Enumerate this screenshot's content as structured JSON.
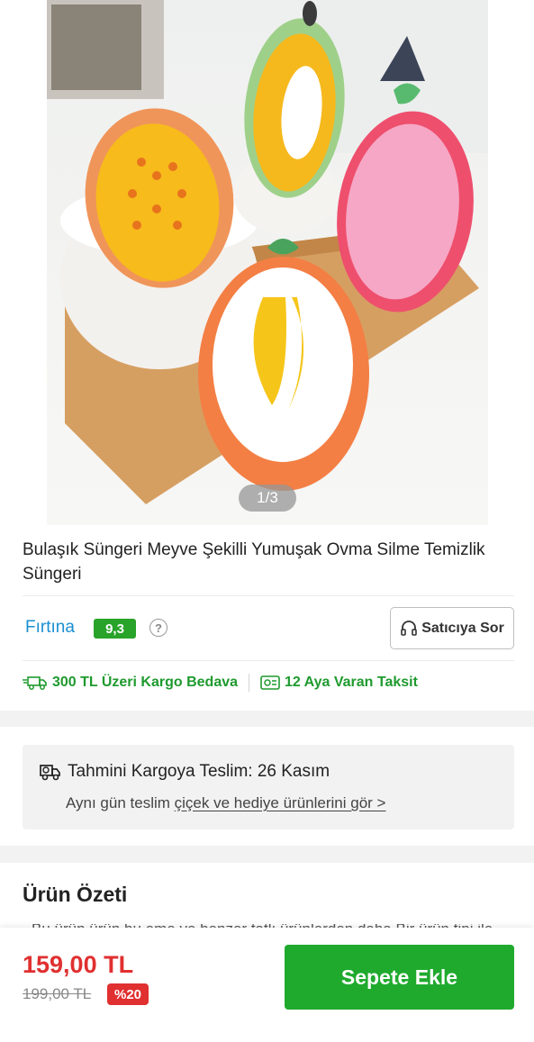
{
  "gallery": {
    "counter": "1/3",
    "image_alt": "fruit-shaped-sponges-photo"
  },
  "product": {
    "title": "Bulaşık Süngeri Meyve Şekilli Yumuşak Ovma Silme Temizlik Süngeri"
  },
  "seller": {
    "name": "Fırtına",
    "rating": "9,3",
    "help_icon": "?",
    "ask_label": "Satıcıya Sor"
  },
  "perks": [
    {
      "icon": "truck-icon",
      "label": "300 TL Üzeri Kargo Bedava"
    },
    {
      "icon": "installment-icon",
      "label": "12 Aya Varan Taksit"
    }
  ],
  "delivery": {
    "icon": "delivery-truck-icon",
    "title": "Tahmini Kargoya Teslim: 26 Kasım",
    "subtitle_prefix": "Aynı gün teslim ",
    "subtitle_link": "çiçek ve hediye ürünlerini gör >"
  },
  "summary": {
    "title": "Ürün Özeti",
    "peek_text": "Bu ürün ürün bu eme ve benzer tatlı ürünlerden daha Bir ürün tipi ile"
  },
  "purchase": {
    "price": "159,00 TL",
    "old_price": "199,00 TL",
    "discount": "%20",
    "cart_label": "Sepete Ekle"
  },
  "colors": {
    "accent_green": "#1faa2e",
    "price_red": "#e03030",
    "seller_blue": "#1a8fd1"
  }
}
